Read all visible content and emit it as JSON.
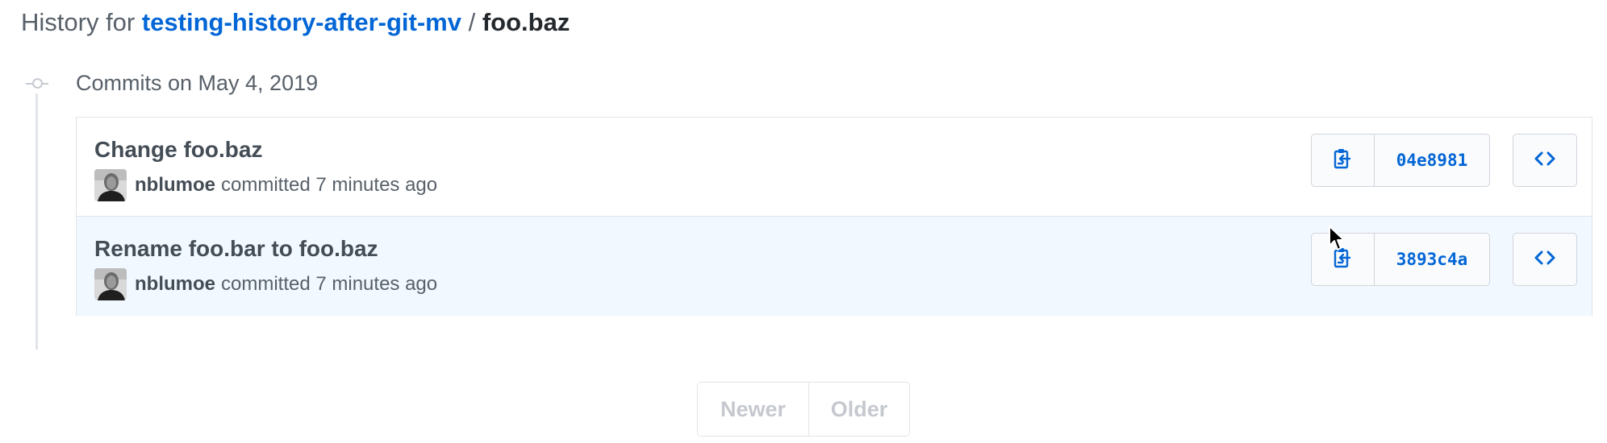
{
  "header": {
    "prefix": "History for ",
    "repo_name": "testing-history-after-git-mv",
    "separator": " / ",
    "file_name": "foo.baz"
  },
  "commit_group": {
    "title": "Commits on May 4, 2019"
  },
  "commits": [
    {
      "title": "Change foo.baz",
      "author": "nblumoe",
      "meta": "committed 7 minutes ago",
      "sha": "04e8981",
      "copy_icon": "clippy-icon",
      "browse_icon": "code-icon"
    },
    {
      "title": "Rename foo.bar to foo.baz",
      "author": "nblumoe",
      "meta": "committed 7 minutes ago",
      "sha": "3893c4a",
      "copy_icon": "clippy-icon",
      "browse_icon": "code-icon"
    }
  ],
  "pagination": {
    "newer_label": "Newer",
    "older_label": "Older"
  },
  "colors": {
    "link": "#0366d6",
    "highlight_row": "#f1f8ff",
    "border": "#e1e4e8",
    "disabled_text": "#c5c9cf"
  }
}
